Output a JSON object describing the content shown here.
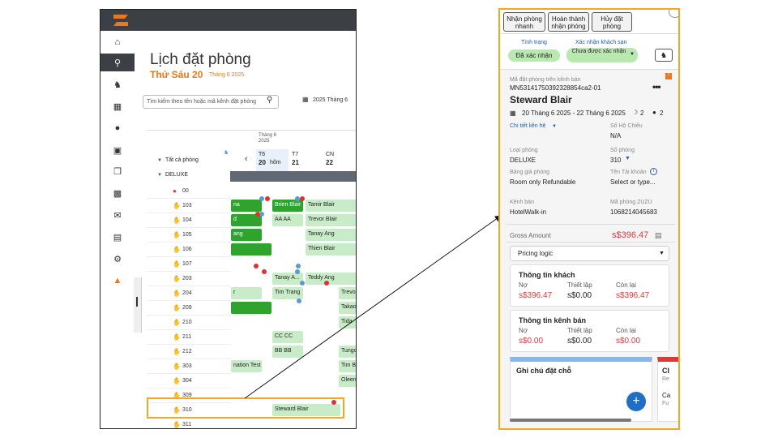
{
  "left": {
    "page_title": "Lịch đặt phòng",
    "date_day": "Thứ Sáu 20",
    "date_month": "Tháng 6 2025",
    "search_placeholder": "Tìm kiếm theo tên hoặc mã kênh đặt phòng",
    "year_month": "2025 Tháng 6",
    "header_month": "Tháng 6",
    "header_year": "2025",
    "days": [
      {
        "dow": "T6",
        "num": "20",
        "extra": "hôm"
      },
      {
        "dow": "T7",
        "num": "21",
        "extra": ""
      },
      {
        "dow": "CN",
        "num": "22",
        "extra": ""
      }
    ],
    "filter_all": "Tất cả phòng",
    "room_type": "DELUXE",
    "rooms": [
      "00",
      "103",
      "104",
      "105",
      "106",
      "107",
      "203",
      "204",
      "209",
      "210",
      "211",
      "212",
      "303",
      "304",
      "309",
      "310",
      "311"
    ],
    "bookings": [
      {
        "text": "na",
        "row": 1,
        "dark": true
      },
      {
        "text": "Brien Blair",
        "row": 1,
        "dark": true
      },
      {
        "text": "Tamir Blair",
        "row": 1,
        "dark": false
      },
      {
        "text": "d",
        "row": 2,
        "dark": true
      },
      {
        "text": "AA AA",
        "row": 2,
        "dark": false
      },
      {
        "text": "Trevor Blair",
        "row": 2,
        "dark": false
      },
      {
        "text": "ang",
        "row": 3,
        "dark": true
      },
      {
        "text": "Tanay Ang",
        "row": 3,
        "dark": false
      },
      {
        "text": "Thien Blair",
        "row": 4,
        "dark": false
      },
      {
        "text": "Tanay A...",
        "row": 6,
        "dark": false
      },
      {
        "text": "Teddy Ang",
        "row": 6,
        "dark": false
      },
      {
        "text": "r",
        "row": 7,
        "dark": false
      },
      {
        "text": "Tim Trang",
        "row": 7,
        "dark": false
      },
      {
        "text": "Trevo",
        "row": 7,
        "dark": false
      },
      {
        "text": "Takao",
        "row": 8,
        "dark": false
      },
      {
        "text": "Tida",
        "row": 9,
        "dark": false
      },
      {
        "text": "CC CC",
        "row": 10,
        "dark": false
      },
      {
        "text": "BB BB",
        "row": 11,
        "dark": false
      },
      {
        "text": "Tungc",
        "row": 11,
        "dark": false
      },
      {
        "text": "nation Test",
        "row": 12,
        "dark": false
      },
      {
        "text": "Tim B",
        "row": 12,
        "dark": false
      },
      {
        "text": "Oleen",
        "row": 13,
        "dark": false
      },
      {
        "text": "Steward Blair",
        "row": 15,
        "dark": false
      }
    ]
  },
  "right": {
    "buttons": [
      "Nhận phòng nhanh",
      "Hoàn thành nhận phòng",
      "Hủy đặt phòng"
    ],
    "status_label": "Tình trạng",
    "status_value": "Đã xác nhận",
    "hotel_confirm_label": "Xác nhận khách sạn",
    "hotel_confirm_value": "Chưa được xác nhận",
    "channel_code_label": "Mã đặt phòng trên kênh bán",
    "channel_code_value": "MN53141750392328854ca2-01",
    "guest_name": "Steward Blair",
    "stay_dates": "20 Tháng 6 2025 - 22 Tháng 6 2025",
    "nights": "2",
    "guests": "2",
    "contact_label": "Chi tiết liên hệ",
    "passport_label": "Số Hộ Chiếu",
    "passport_value": "N/A",
    "room_type_label": "Loại phòng",
    "room_type_value": "DELUXE",
    "room_number_label": "Số phòng",
    "room_number_value": "310",
    "rate_label": "Bảng giá phòng",
    "rate_value": "Room only Refundable",
    "account_label": "Tên Tài khoản",
    "account_value": "Select or type...",
    "channel_label": "Kênh bán",
    "channel_value": "HotelWalk-in",
    "zuzu_label": "Mã phòng ZUZU",
    "zuzu_value": "1068214045683",
    "gross_label": "Gross Amount",
    "gross_value": "s$396.47",
    "pricing_logic": "Pricing logic",
    "guest_info_title": "Thông tin khách",
    "channel_info_title": "Thông tin kênh bán",
    "col_debt": "Nợ",
    "col_set": "Thiết lập",
    "col_remaining": "Còn lại",
    "guest_debt": "s$396.47",
    "guest_set": "s$0.00",
    "guest_remaining": "s$396.47",
    "channel_debt": "s$0.00",
    "channel_set": "s$0.00",
    "channel_remaining": "s$0.00",
    "note_title": "Ghi chú đặt chỗ",
    "peek_title": "Cl",
    "peek_a": "Re",
    "peek_b": "Ca",
    "peek_c": "Fu"
  },
  "colors": {
    "accent": "#e8791f",
    "highlight": "#f5a623",
    "booking_light": "#c8ecc8",
    "booking_dark": "#2ea32e",
    "topbar": "#3c3f44"
  }
}
